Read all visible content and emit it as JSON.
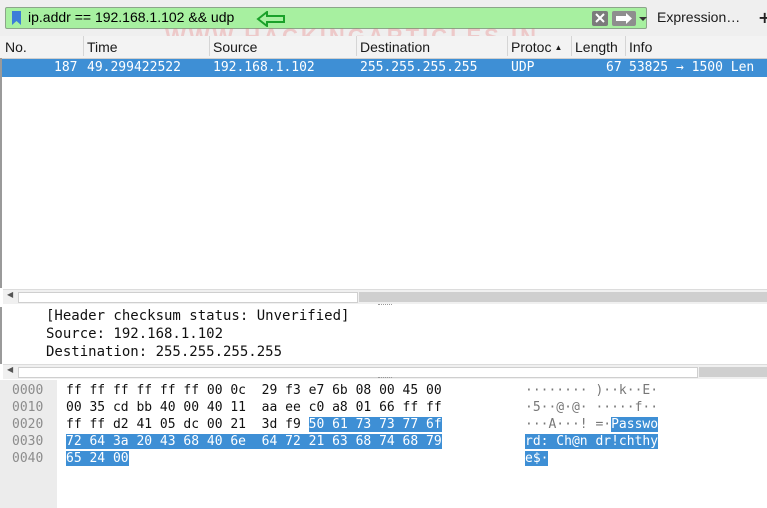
{
  "filter": {
    "text": "ip.addr == 192.168.1.102 && udp",
    "expression_label": "Expression…",
    "add_label": "+"
  },
  "watermark": "WWW.HACKINGARTICLES.IN",
  "columns": [
    "No.",
    "Time",
    "Source",
    "Destination",
    "Protoc",
    "Length",
    "Info"
  ],
  "packets": [
    {
      "no": "187",
      "time": "49.299422522",
      "source": "192.168.1.102",
      "destination": "255.255.255.255",
      "protocol": "UDP",
      "length": "67",
      "info": "53825 → 1500 Len"
    }
  ],
  "details": [
    "[Header checksum status: Unverified]",
    "Source: 192.168.1.102",
    "Destination: 255.255.255.255"
  ],
  "bytes": [
    {
      "offset": "0000",
      "hex_plain": "ff ff ff ff ff ff 00 0c  29 f3 e7 6b 08 00 45 00",
      "hex_hl": "",
      "ascii_plain": "········ )··k··E·",
      "ascii_hl": ""
    },
    {
      "offset": "0010",
      "hex_plain": "00 35 cd bb 40 00 40 11  aa ee c0 a8 01 66 ff ff",
      "hex_hl": "",
      "ascii_plain": "·5··@·@· ·····f··",
      "ascii_hl": ""
    },
    {
      "offset": "0020",
      "hex_plain": "ff ff d2 41 05 dc 00 21  3d f9 ",
      "hex_hl": "50 61 73 73 77 6f",
      "ascii_plain": "···A···! =·",
      "ascii_hl": "Passwo"
    },
    {
      "offset": "0030",
      "hex_plain": "",
      "hex_hl": "72 64 3a 20 43 68 40 6e  64 72 21 63 68 74 68 79",
      "ascii_plain": "",
      "ascii_hl": "rd: Ch@n dr!chthy"
    },
    {
      "offset": "0040",
      "hex_plain": "",
      "hex_hl": "65 24 00",
      "ascii_plain": "",
      "ascii_hl": "e$·"
    }
  ]
}
